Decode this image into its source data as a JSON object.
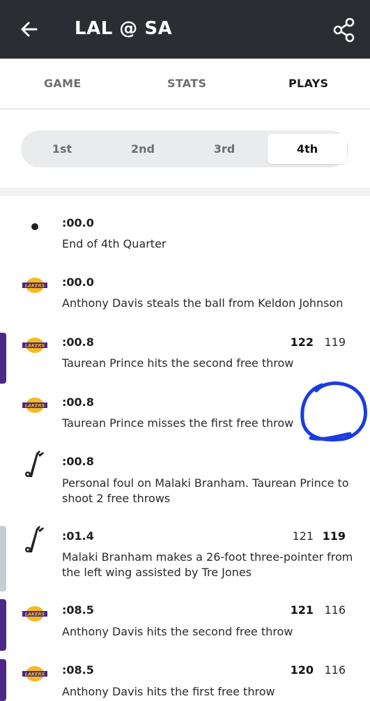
{
  "header": {
    "title": "LAL @ SA",
    "back_icon": "arrow-left-icon",
    "share_icon": "share-icon",
    "bg_color": "#2a2d31"
  },
  "tabs": [
    {
      "label": "GAME",
      "active": false
    },
    {
      "label": "STATS",
      "active": false
    },
    {
      "label": "PLAYS",
      "active": true
    }
  ],
  "quarters": [
    {
      "label": "1st",
      "active": false
    },
    {
      "label": "2nd",
      "active": false
    },
    {
      "label": "3rd",
      "active": false
    },
    {
      "label": "4th",
      "active": true
    }
  ],
  "plays": [
    {
      "time": ":00.0",
      "desc": "End of 4th Quarter",
      "team": "none",
      "score_home": "",
      "score_away": ""
    },
    {
      "time": ":00.0",
      "desc": "Anthony Davis steals the ball from Keldon Johnson",
      "team": "LAL",
      "score_home": "",
      "score_away": ""
    },
    {
      "time": ":00.8",
      "desc": "Taurean Prince hits the second free throw",
      "team": "LAL",
      "score_home": "122",
      "score_away": "119",
      "scoring": "home"
    },
    {
      "time": ":00.8",
      "desc": "Taurean Prince misses the first free throw",
      "team": "LAL",
      "score_home": "",
      "score_away": ""
    },
    {
      "time": ":00.8",
      "desc": "Personal foul on Malaki Branham. Taurean Prince to shoot 2 free throws",
      "team": "SA",
      "score_home": "",
      "score_away": ""
    },
    {
      "time": ":01.4",
      "desc": "Malaki Branham makes a 26-foot three-pointer from the left wing assisted by Tre Jones",
      "team": "SA",
      "score_home": "121",
      "score_away": "119",
      "scoring": "away"
    },
    {
      "time": ":08.5",
      "desc": "Anthony Davis hits the second free throw",
      "team": "LAL",
      "score_home": "121",
      "score_away": "116",
      "scoring": "home"
    },
    {
      "time": ":08.5",
      "desc": "Anthony Davis hits the first free throw",
      "team": "LAL",
      "score_home": "120",
      "score_away": "116",
      "scoring": "home"
    }
  ],
  "team_logos": {
    "LAL": {
      "text": "LAKERS",
      "icon": "lakers-logo-icon",
      "color": "#4a2a86",
      "accent": "#f5b921"
    },
    "SA": {
      "icon": "spurs-logo-icon",
      "color": "#c4ced4"
    }
  },
  "annotation": {
    "icon": "blue-circle-annotation",
    "color": "#1a3de0"
  }
}
